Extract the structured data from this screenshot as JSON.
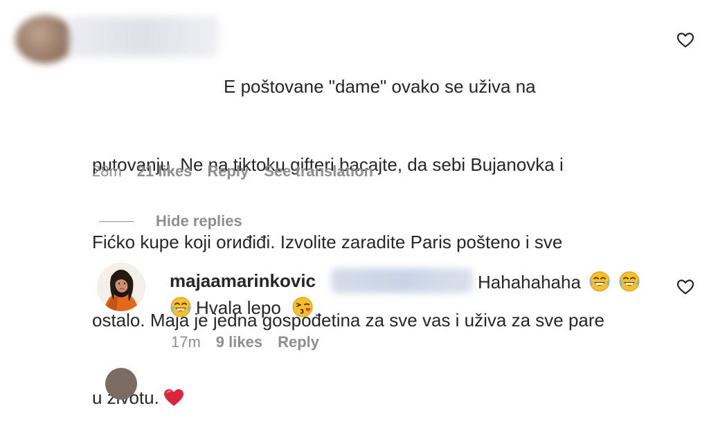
{
  "comment": {
    "text_line1": "E poštovane \"dame\" ovako se uživa na",
    "text_line2": "putovanju. Ne na tiktoku gifteri bacajte, da sebi Bujanovka i",
    "text_line3": "Fićko kupe koji orиđiđi. Izvolite zaradite Paris pošteno i sve",
    "text_line4": "ostalo. Maja je jedna gospođetina za sve vas i uživa za sve pare",
    "text_line5": "u životu.",
    "emoji": "heart",
    "time": "28m",
    "likes": "21 likes",
    "reply_label": "Reply",
    "translate_label": "See translation"
  },
  "thread": {
    "hide_replies_label": "Hide replies"
  },
  "reply": {
    "username": "majaamarinkovic",
    "text_part1": "Hahahahaha",
    "text_part2": "Hvala lepo",
    "emojis": [
      "tears-of-joy",
      "tears-of-joy",
      "tears-of-joy",
      "kissing-face"
    ],
    "time": "17m",
    "likes": "9 likes",
    "reply_label": "Reply"
  },
  "colors": {
    "text": "#262626",
    "secondary": "#8e8e8e",
    "heart": "#d7263d"
  }
}
